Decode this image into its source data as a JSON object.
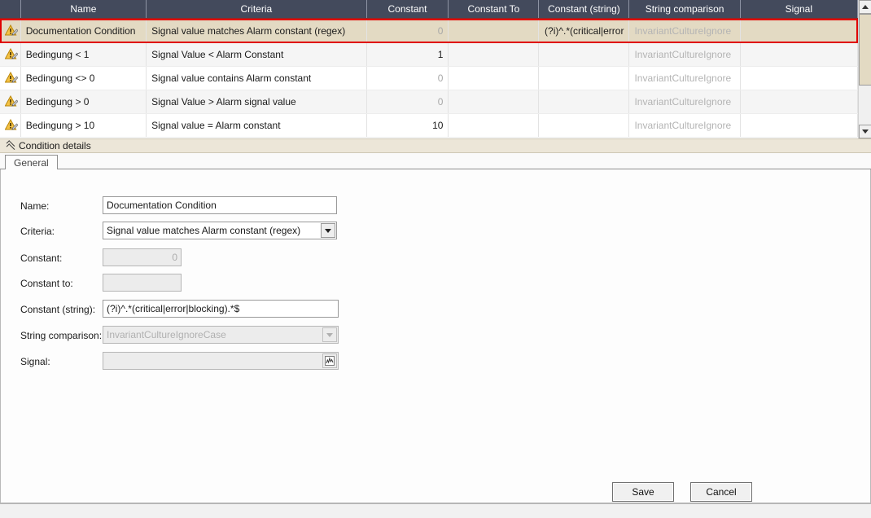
{
  "grid": {
    "columns": [
      {
        "key": "icon",
        "label": ""
      },
      {
        "key": "name",
        "label": "Name"
      },
      {
        "key": "criteria",
        "label": "Criteria"
      },
      {
        "key": "constant",
        "label": "Constant"
      },
      {
        "key": "constant_to",
        "label": "Constant To"
      },
      {
        "key": "constant_string",
        "label": "Constant (string)"
      },
      {
        "key": "string_comparison",
        "label": "String comparison"
      },
      {
        "key": "signal",
        "label": "Signal"
      }
    ],
    "rows": [
      {
        "icon": "warning-edit-icon",
        "name": "Documentation Condition",
        "criteria": "Signal value matches Alarm constant (regex)",
        "constant": "0",
        "constant_muted": true,
        "constant_to": "",
        "constant_string": "(?i)^.*(critical|error",
        "string_comparison": "InvariantCultureIgnore",
        "string_comparison_muted": true,
        "signal": "",
        "selected": true
      },
      {
        "icon": "warning-edit-icon",
        "name": "Bedingung < 1",
        "criteria": "Signal Value < Alarm Constant",
        "constant": "1",
        "constant_muted": false,
        "constant_to": "",
        "constant_string": "",
        "string_comparison": "InvariantCultureIgnore",
        "string_comparison_muted": true,
        "signal": "",
        "selected": false
      },
      {
        "icon": "warning-edit-icon",
        "name": "Bedingung <> 0",
        "criteria": "Signal value contains Alarm constant",
        "constant": "0",
        "constant_muted": true,
        "constant_to": "",
        "constant_string": "",
        "string_comparison": "InvariantCultureIgnore",
        "string_comparison_muted": true,
        "signal": "",
        "selected": false
      },
      {
        "icon": "warning-edit-icon",
        "name": "Bedingung > 0",
        "criteria": "Signal Value > Alarm signal value",
        "constant": "0",
        "constant_muted": true,
        "constant_to": "",
        "constant_string": "",
        "string_comparison": "InvariantCultureIgnore",
        "string_comparison_muted": true,
        "signal": "",
        "selected": false
      },
      {
        "icon": "warning-edit-icon",
        "name": "Bedingung > 10",
        "criteria": "Signal value = Alarm constant",
        "constant": "10",
        "constant_muted": false,
        "constant_to": "",
        "constant_string": "",
        "string_comparison": "InvariantCultureIgnore",
        "string_comparison_muted": true,
        "signal": "",
        "selected": false
      }
    ],
    "scrollbar": {
      "up_icon": "scroll-up-arrow-icon",
      "down_icon": "scroll-down-arrow-icon"
    }
  },
  "details_bar": {
    "title": "Condition details",
    "collapse_icon": "double-chevron-up-icon"
  },
  "tabs": [
    {
      "label": "General",
      "active": true
    }
  ],
  "form": {
    "name": {
      "label": "Name:",
      "value": "Documentation Condition",
      "disabled": false
    },
    "criteria": {
      "label": "Criteria:",
      "value": "Signal value matches Alarm constant (regex)",
      "disabled": false,
      "dropdown_icon": "chevron-down-icon"
    },
    "constant": {
      "label": "Constant:",
      "value": "0",
      "disabled": true
    },
    "constant_to": {
      "label": "Constant to:",
      "value": "",
      "disabled": true
    },
    "constant_string": {
      "label": "Constant (string):",
      "value": "(?i)^.*(critical|error|blocking).*$",
      "disabled": false
    },
    "string_comparison": {
      "label": "String comparison:",
      "value": "InvariantCultureIgnoreCase",
      "disabled": true,
      "dropdown_icon": "chevron-down-icon"
    },
    "signal": {
      "label": "Signal:",
      "value": "",
      "disabled": true,
      "browse_icon": "signal-chart-icon"
    }
  },
  "footer": {
    "save_label": "Save",
    "cancel_label": "Cancel"
  },
  "colors": {
    "header_bg": "#434a5c",
    "header_accent": "#8c2b2b",
    "selection_border": "#e00000",
    "selection_bg": "#e3dac3",
    "details_bar_bg": "#ece6d8",
    "warn_icon": "#f0a91e"
  }
}
